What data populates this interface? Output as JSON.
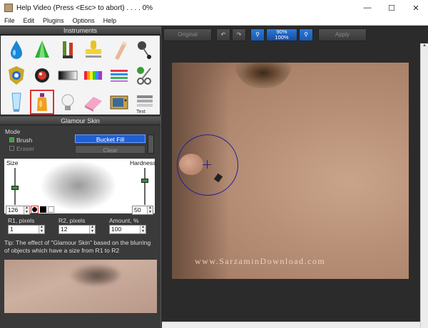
{
  "window": {
    "title": "Help Video (Press <Esc> to abort) . . . . 0%",
    "minimize_icon": "minimize-icon",
    "maximize_icon": "maximize-icon",
    "close_icon": "close-icon"
  },
  "menu": [
    "File",
    "Edit",
    "Plugins",
    "Options",
    "Help"
  ],
  "instruments": {
    "header": "Instruments",
    "tools": [
      "drop-tool-icon",
      "cone-tool-icon",
      "tube-tool-icon",
      "stamp-tool-icon",
      "finger-tool-icon",
      "pin-tool-icon",
      "shield-tool-icon",
      "eye-tool-icon",
      "gradient-tool-icon",
      "spectrum-tool-icon",
      "lines-tool-icon",
      "scissors-tool-icon",
      "glass-tool-icon",
      "bottle-tool-icon",
      "bulb-tool-icon",
      "eraser-tool-icon",
      "tv-tool-icon",
      "text-tool-icon"
    ],
    "selected_index": 13,
    "text_tool_label": "Text"
  },
  "glamour": {
    "header": "Glamour Skin",
    "mode_label": "Mode",
    "brush_label": "Brush",
    "eraser_label": "Eraser",
    "bucket_fill_label": "Bucket Fill",
    "clear_label": "Clear",
    "size_label": "Size",
    "hardness_label": "Hardness",
    "size_value": "126",
    "hardness_value": "50",
    "r1_label": "R1, pixels",
    "r1_value": "1",
    "r2_label": "R2, pixels",
    "r2_value": "12",
    "amount_label": "Amount, %",
    "amount_value": "100",
    "tip": "Tip: The effect of \"Glamour Skin\" based on the blurring of objects which have a size from R1 to R2"
  },
  "toolbar": {
    "original_label": "Original",
    "apply_label": "Apply",
    "zoom_top": "90%",
    "zoom_bottom": "100%",
    "undo_icon": "undo-icon",
    "redo_icon": "redo-icon",
    "zoom_in_icon": "zoom-in-icon",
    "zoom_out_icon": "zoom-out-icon"
  },
  "canvas": {
    "watermark": "www.SarzaminDownload.com"
  },
  "colors": {
    "accent": "#1f5fd6",
    "panel": "#3a3a3a",
    "selection": "#e03030"
  }
}
